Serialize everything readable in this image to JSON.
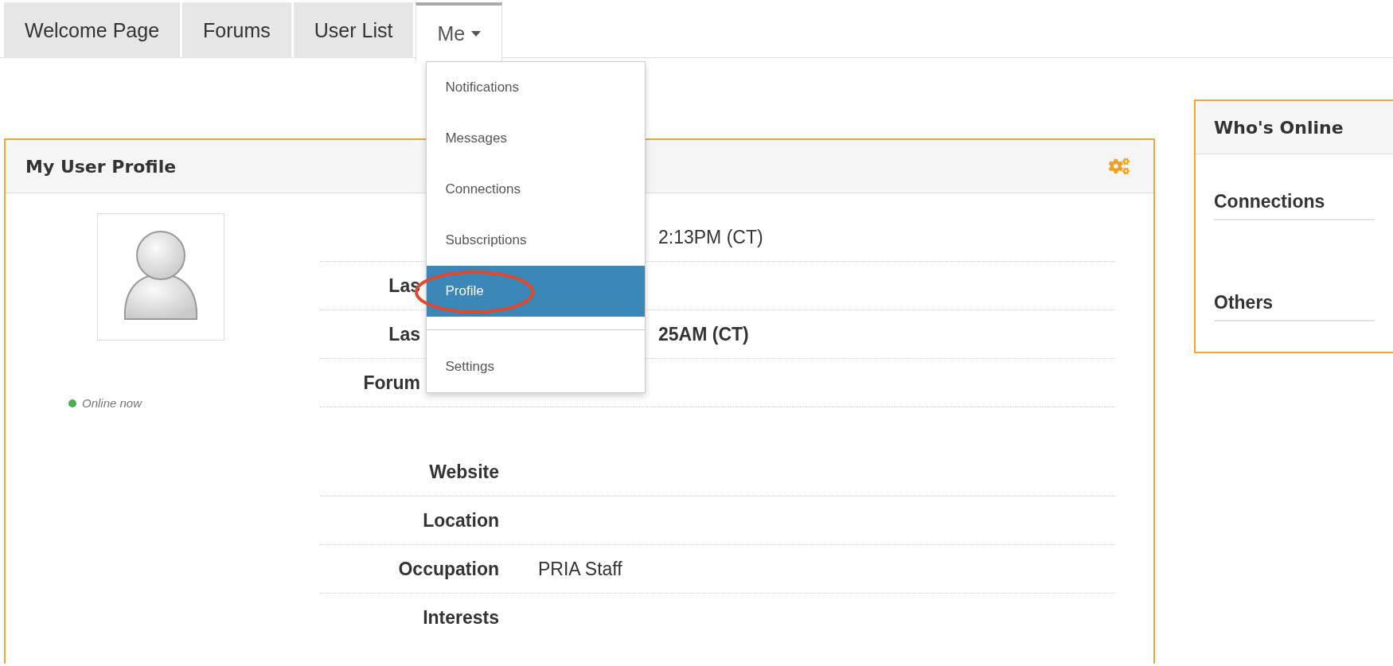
{
  "tabs": [
    {
      "label": "Welcome Page",
      "selected": false,
      "dropdown": false
    },
    {
      "label": "Forums",
      "selected": false,
      "dropdown": false
    },
    {
      "label": "User List",
      "selected": false,
      "dropdown": false
    },
    {
      "label": "Me",
      "selected": true,
      "dropdown": true
    }
  ],
  "menu": {
    "groups": [
      [
        {
          "label": "Notifications",
          "selected": false
        },
        {
          "label": "Messages",
          "selected": false
        },
        {
          "label": "Connections",
          "selected": false
        },
        {
          "label": "Subscriptions",
          "selected": false
        },
        {
          "label": "Profile",
          "selected": true
        }
      ],
      [
        {
          "label": "Settings",
          "selected": false
        }
      ]
    ]
  },
  "profile": {
    "title": "My User Profile",
    "status": "Online now",
    "rows": [
      {
        "kind": "covered",
        "value": "2:13PM (CT)",
        "bold": false
      },
      {
        "kind": "covered",
        "label": "Las"
      },
      {
        "kind": "covered",
        "label": "Las",
        "value": "25AM (CT)",
        "bold": true
      },
      {
        "kind": "covered",
        "label": "Forum"
      },
      {
        "kind": "field",
        "label": "Website"
      },
      {
        "kind": "field",
        "label": "Location"
      },
      {
        "kind": "field",
        "label": "Occupation",
        "value": "PRIA Staff",
        "bold": false
      },
      {
        "kind": "field",
        "label": "Interests"
      }
    ]
  },
  "whos_online": {
    "title": "Who's Online",
    "sections": [
      "Connections",
      "Others"
    ]
  }
}
